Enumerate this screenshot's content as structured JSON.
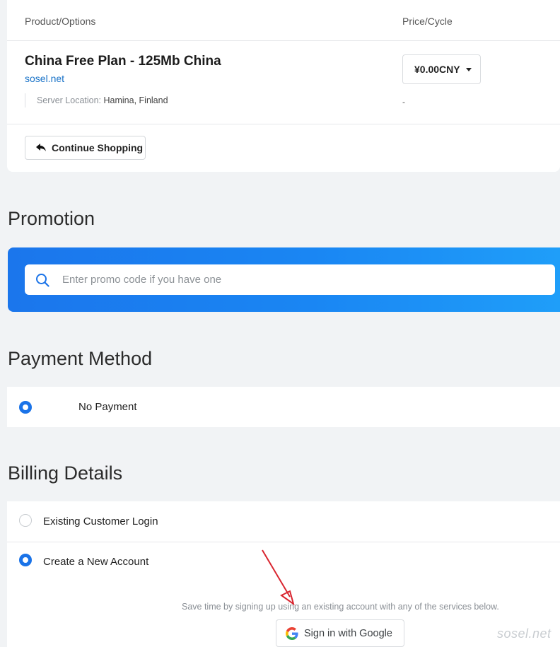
{
  "product_table": {
    "col_product": "Product/Options",
    "col_price": "Price/Cycle",
    "product_name": "China Free Plan - 125Mb China",
    "product_domain": "sosel.net",
    "location_label": "Server Location:",
    "location_value": "Hamina, Finland",
    "price_value": "¥0.00CNY",
    "cycle_value": "-",
    "continue_label": "Continue Shopping"
  },
  "promotion": {
    "title": "Promotion",
    "placeholder": "Enter promo code if you have one"
  },
  "payment": {
    "title": "Payment Method",
    "option_label": "No Payment",
    "selected": true
  },
  "billing": {
    "title": "Billing Details",
    "options": [
      {
        "label": "Existing Customer Login",
        "selected": false
      },
      {
        "label": "Create a New Account",
        "selected": true
      }
    ],
    "save_text": "Save time by signing up using an existing account with any of the services below.",
    "google_label": "Sign in with Google"
  },
  "watermark": "sosel.net",
  "colors": {
    "accent": "#1a73e8",
    "link": "#1a73c8",
    "annotation_arrow": "#d9252f"
  }
}
